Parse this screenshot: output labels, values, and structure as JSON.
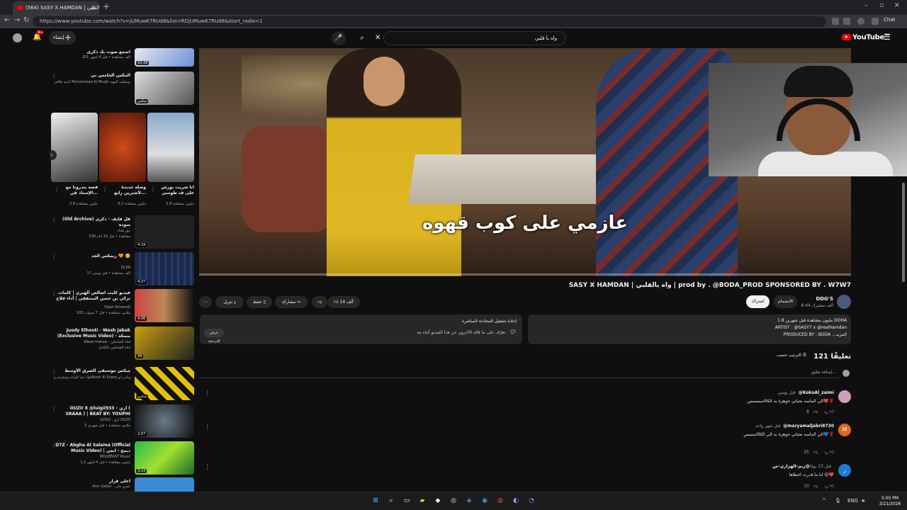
{
  "browser": {
    "tab_title": "(564) SASY X HAMDAN | واه يالقلبي",
    "url": "https://www.youtube.com/watch?v=jUMuwK7RUd8&list=RDjUMuwK7RUd8&start_radio=1",
    "chat_label": "Chat",
    "new_tab": "+"
  },
  "header": {
    "logo_text": "YouTube",
    "logo_region": "SA",
    "search_query": "واه يا قلبي",
    "create_label": "إنشاء",
    "notif_count": "9+"
  },
  "video": {
    "caption": "عازمي على كوب قهوه",
    "title": "SASY X HAMDAN | واه يالقلبي | prod by . @BODA_PROD SPONSORED BY . W7W7",
    "channel": "DDG'S",
    "subscribers": "8.44 ألف مشترك",
    "subscribe_label": "اشتراك",
    "join_label": "الانضمام",
    "likes": "14 ألف",
    "share_label": "مشاركة",
    "save_label": "حفظ",
    "download_label": "تنزيل"
  },
  "description": {
    "line1": "1.8 مليون مشاهدة  قبل شهرين  DOHA",
    "line2": "ARTIST : @SASY7 x @realhamdan",
    "line3": "PRODUCED BY : BODA ...المزيد"
  },
  "live_chat": {
    "title": "إعادة تشغيل المحادثة المباشرة",
    "text": "تعرّف على ما قاله الآخرون عن هذا الفيديو أثناء بثه.",
    "button": "عرض الدردشة"
  },
  "comments": {
    "count": "121 تعليقًا",
    "sort_label": "الترتيب حسب",
    "add_placeholder": "إضافة تعليق...",
    "items": [
      {
        "author": "@KokoAl_zaimi",
        "time": "قبل يومين",
        "text": "الي الماسه بحياتي جوهرة يه الكاااسسسس❤️🌹",
        "likes": "8",
        "reply": "رد",
        "avatar_letter": "",
        "avatar_color": "#c9a0b8"
      },
      {
        "author": "@maryamaljabri8730",
        "time": "قبل شهر واحد",
        "text": "الي الماسه بحياتي جوهرة يه الي الكاااسسس💙🌹",
        "likes": "25",
        "reply": "رد",
        "avatar_letter": "M",
        "avatar_color": "#e0661e"
      },
      {
        "author": "@ريم-الهزازي-ص",
        "time": "قبل 13 يومًا",
        "text": "انا ما قدرت اخطاها 😔❤️",
        "likes": "10",
        "reply": "رد",
        "avatar_letter": "ر",
        "avatar_color": "#1e7ad6"
      }
    ]
  },
  "sidebar": {
    "related": [
      {
        "title": "اسمع صوت بك ذكرى",
        "channel": "",
        "stats": "201 ألف مشاهدة • قبل 4 أشهر",
        "duration": "10:38"
      },
      {
        "title": "المكس الخامس بي",
        "channel": "أغنية طاقي Muhammad Al-Muqit وسلفيد المهند...",
        "stats": "",
        "duration": "ميكس"
      },
      {
        "title": "(Old Archive) قل فايف - ذكرى سوده",
        "channel": "بيق بغداد",
        "stats": "230 مشاهدة • قبل 10 أيام",
        "duration": "4:19"
      },
      {
        "title": "ريمكس الجد 🧡 🥺",
        "channel": "DJ K6",
        "stats": "17 ألف مشاهدة • قبل يومين",
        "duration": "4:27"
      },
      {
        "title": "فيديو كليب اصالص الهيري | كلمات تركي بن حسن المنتفقي | أداء فلاح المسردي",
        "channel": "Falah Almesrdi",
        "stats": "103 ملايين مشاهدة • قبل 7 سنوات",
        "duration": "4:06"
      },
      {
        "title": "Juody Elhouti - Wesh Jabak (Exclusive Music Video) - مسكة",
        "channel": "Waad manaa - قناة الشاملين",
        "stats": "قناة الشاملين بالكامل",
        "duration": "49"
      },
      {
        "title": "ميكس موسيقى الشرق الأوسط",
        "channel": "فؤاد عبد الواحد وسلوجر وRouh Al Sharq وتامر أبو...",
        "stats": "",
        "duration": "ميكس"
      },
      {
        "title": "OUZII X @luigii933 - أزي ( SRAAA ) | BEAT BY: YOUPHI",
        "channel": "LUIGII - أزي OUZII",
        "stats": "3 ملايين مشاهدة • قبل شهرين",
        "duration": "2:07"
      },
      {
        "title": "D7Z - Abgha Al Salama (Official Music Video) | ديمح - ابغي السلامة",
        "channel": "MDLBEAST Music",
        "stats": "1.2 مليون مشاهدة • قبل 4 أشهر",
        "duration": "3:14"
      },
      {
        "title": "اعلى قرار",
        "channel": "Amr Gaber - عمرو جابر",
        "stats": "",
        "duration": ""
      }
    ],
    "shorts": [
      {
        "title": "قصة بتدرونا مع الإستاذ في...",
        "views": "2.8 مليون مشاهدة"
      },
      {
        "title": "وصلة جديدة لأشترين رابع...",
        "views": "6.2 مليون مشاهدة"
      },
      {
        "title": "انا شريت بورش على قد طوسي",
        "views": "2.9 مليون مشاهدة"
      }
    ]
  },
  "taskbar": {
    "time": "5:05 PM",
    "date": "3/21/2026",
    "lang": "ENG"
  },
  "colors": {
    "brand": "#ff0000",
    "background": "#0f0f0f",
    "surface": "#272727"
  }
}
